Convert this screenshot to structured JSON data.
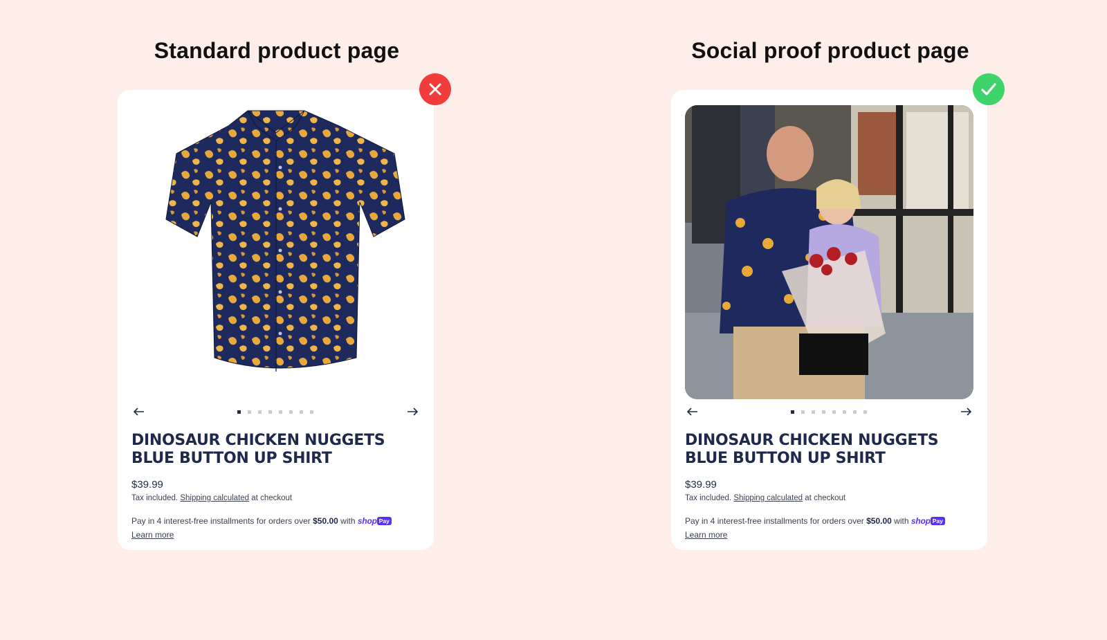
{
  "colors": {
    "background": "#fdeeea",
    "title": "#1f2a4a",
    "bad_badge": "#f23b3b",
    "good_badge": "#3fd46a",
    "shop_pay": "#5a31f4"
  },
  "left": {
    "heading": "Standard product page",
    "badge_icon": "x-icon",
    "image": "product-shirt-image",
    "title": "DINOSAUR CHICKEN NUGGETS BLUE BUTTON UP SHIRT",
    "price": "$39.99",
    "tax_prefix": "Tax included.",
    "shipping_link": "Shipping calculated",
    "tax_suffix": "at checkout",
    "installments_text": "Pay in 4 interest-free installments for orders over",
    "installments_amount": "$50.00",
    "with": "with",
    "shop_word": "shop",
    "pay_word": "Pay",
    "learn_more": "Learn more"
  },
  "right": {
    "heading": "Social proof product page",
    "badge_icon": "check-icon",
    "image": "customer-photo-image",
    "title": "DINOSAUR CHICKEN NUGGETS BLUE BUTTON UP SHIRT",
    "price": "$39.99",
    "tax_prefix": "Tax included.",
    "shipping_link": "Shipping calculated",
    "tax_suffix": "at checkout",
    "installments_text": "Pay in 4 interest-free installments for orders over",
    "installments_amount": "$50.00",
    "with": "with",
    "shop_word": "shop",
    "pay_word": "Pay",
    "learn_more": "Learn more"
  },
  "carousel": {
    "dot_count": 8,
    "active_index": 0
  }
}
